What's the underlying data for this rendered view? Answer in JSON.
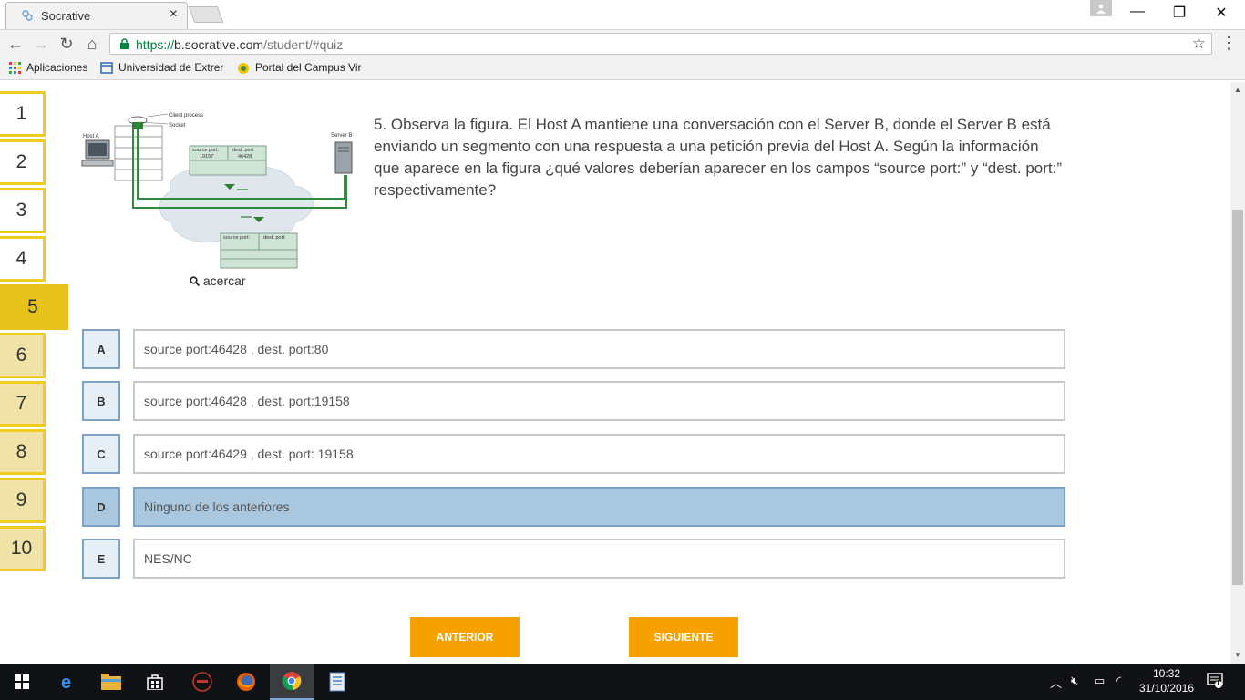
{
  "browser": {
    "tab_title": "Socrative",
    "url_scheme": "https://",
    "url_host": "b.socrative.com",
    "url_path": "/student/#quiz",
    "bookmarks": [
      "Aplicaciones",
      "Universidad de Extrem",
      "Portal del Campus Vir"
    ]
  },
  "quiz": {
    "question_numbers": [
      "1",
      "2",
      "3",
      "4",
      "5",
      "6",
      "7",
      "8",
      "9",
      "10"
    ],
    "current_question": "5",
    "question_text": "5. Observa la figura. El Host A mantiene una conversación con el Server B, donde el Server B está enviando un segmento con una respuesta a una petición previa del Host A. Según la información que aparece en la figura ¿qué valores deberían aparecer en los campos “source port:” y “dest. port:” respectivamente?",
    "zoom_label": "acercar",
    "figure": {
      "client_process": "Client process",
      "socket": "Socket",
      "host_a": "Host A",
      "server_b": "Server B",
      "source_port_label": "source port:",
      "source_port_value": "19157",
      "dest_port_label": "dest. port:",
      "dest_port_value": "46428"
    },
    "options": [
      {
        "letter": "A",
        "text": "source port:46428 , dest. port:80"
      },
      {
        "letter": "B",
        "text": "source port:46428 , dest. port:19158"
      },
      {
        "letter": "C",
        "text": "source port:46429 , dest. port: 19158"
      },
      {
        "letter": "D",
        "text": "Ninguno de los anteriores"
      },
      {
        "letter": "E",
        "text": "NES/NC"
      }
    ],
    "selected_option": "D",
    "prev_label": "ANTERIOR",
    "next_label": "SIGUIENTE"
  },
  "taskbar": {
    "time": "10:32",
    "date": "31/10/2016",
    "notification_count": "1"
  }
}
